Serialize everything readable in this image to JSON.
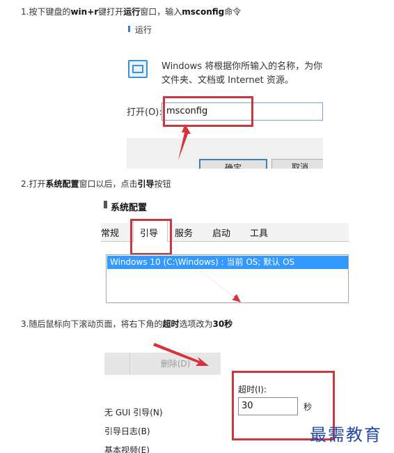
{
  "steps": {
    "s1": {
      "a": "1.按下键盘的",
      "b": "win+r",
      "c": "键打开",
      "d": "运行",
      "e": "窗口，输入",
      "f": "msconfig",
      "g": "命令"
    },
    "s2": {
      "a": "2.打开",
      "b": "系统配置",
      "c": "窗口以后，点击",
      "d": "引导",
      "e": "按钮"
    },
    "s3": {
      "a": "3.随后鼠标向下滚动页面，将右下角的",
      "b": "超时",
      "c": "选项改为",
      "d": "30秒"
    }
  },
  "run_dialog": {
    "title": "运行",
    "desc_line1": "Windows 将根据你所输入的名称，为你",
    "desc_line2": "文件夹、文档或 Internet 资源。",
    "open_label": "打开(O):",
    "input_value": "msconfig",
    "ok_label": "确定",
    "cancel_label": "取消"
  },
  "sysconfig": {
    "title": "系统配置",
    "tabs": [
      "常规",
      "引导",
      "服务",
      "启动",
      "工具"
    ],
    "active_tab": "引导",
    "list_item": "Windows 10 (C:\\Windows) : 当前 OS; 默认 OS"
  },
  "boot": {
    "delete_label": "删除(D)",
    "options": [
      "无 GUI 引导(N)",
      "引导日志(B)",
      "基本视频(E)"
    ],
    "timeout_label": "超时(I):",
    "timeout_value": "30",
    "timeout_unit": "秒"
  },
  "watermark": "最需教育",
  "colors": {
    "highlight": "#c9373f",
    "selection": "#3399ff",
    "watermark": "#2348a8"
  }
}
